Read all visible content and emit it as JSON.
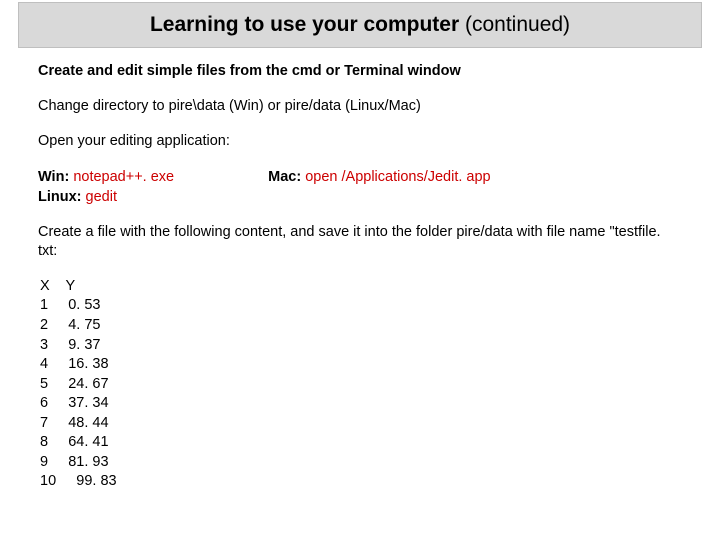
{
  "header": {
    "bold": "Learning to use your computer",
    "normal": " (continued)"
  },
  "lines": {
    "subhead": "Create and edit simple files from the cmd or Terminal window",
    "cd": "Change directory to pire\\data (Win) or pire/data (Linux/Mac)",
    "openapp": "Open your editing application:",
    "createfile": "Create a file with the following content, and save it into the folder pire/data with file name \"testfile. txt:"
  },
  "cmds": {
    "win_lbl": "Win:  ",
    "win_cmd": "notepad++. exe",
    "mac_lbl": "Mac: ",
    "mac_cmd": "open /Applications/Jedit. app",
    "linux_lbl": "Linux: ",
    "linux_cmd": "gedit"
  },
  "table": {
    "rows": [
      "X    Y",
      "1     0. 53",
      "2     4. 75",
      "3     9. 37",
      "4     16. 38",
      "5     24. 67",
      "6     37. 34",
      "7     48. 44",
      "8     64. 41",
      "9     81. 93",
      "10     99. 83"
    ]
  },
  "chart_data": {
    "type": "table",
    "columns": [
      "X",
      "Y"
    ],
    "rows": [
      [
        1,
        0.53
      ],
      [
        2,
        4.75
      ],
      [
        3,
        9.37
      ],
      [
        4,
        16.38
      ],
      [
        5,
        24.67
      ],
      [
        6,
        37.34
      ],
      [
        7,
        48.44
      ],
      [
        8,
        64.41
      ],
      [
        9,
        81.93
      ],
      [
        10,
        99.83
      ]
    ]
  }
}
